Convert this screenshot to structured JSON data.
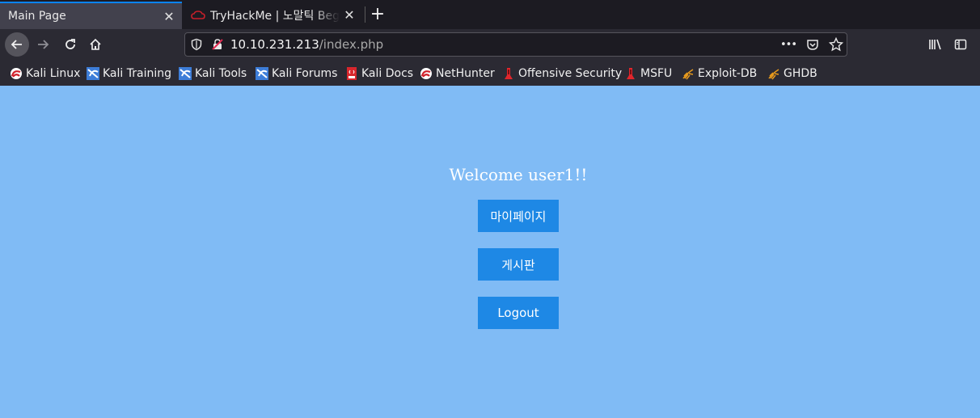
{
  "browser": {
    "tabs": [
      {
        "label": "Main Page",
        "active": true
      },
      {
        "label": "TryHackMe | 노말틱 Beginner",
        "active": false
      }
    ],
    "close_glyph": "✕",
    "newtab_glyph": "+",
    "url": {
      "host": "10.10.231.213",
      "path": "/index.php"
    },
    "url_menu_glyph": "•••",
    "bookmarks": [
      {
        "label": "Kali Linux",
        "icon": "kali-icon"
      },
      {
        "label": "Kali Training",
        "icon": "kali-dragon-icon"
      },
      {
        "label": "Kali Tools",
        "icon": "kali-dragon-icon"
      },
      {
        "label": "Kali Forums",
        "icon": "kali-dragon-icon"
      },
      {
        "label": "Kali Docs",
        "icon": "kali-docs-icon"
      },
      {
        "label": "NetHunter",
        "icon": "kali-icon"
      },
      {
        "label": "Offensive Security",
        "icon": "offsec-icon"
      },
      {
        "label": "MSFU",
        "icon": "offsec-icon"
      },
      {
        "label": "Exploit-DB",
        "icon": "exploitdb-icon"
      },
      {
        "label": "GHDB",
        "icon": "exploitdb-icon"
      }
    ]
  },
  "page": {
    "welcome": "Welcome user1!!",
    "buttons": [
      "마이페이지",
      "게시판",
      "Logout"
    ],
    "background_color": "#80bbf5",
    "button_color": "#1e88e5"
  }
}
